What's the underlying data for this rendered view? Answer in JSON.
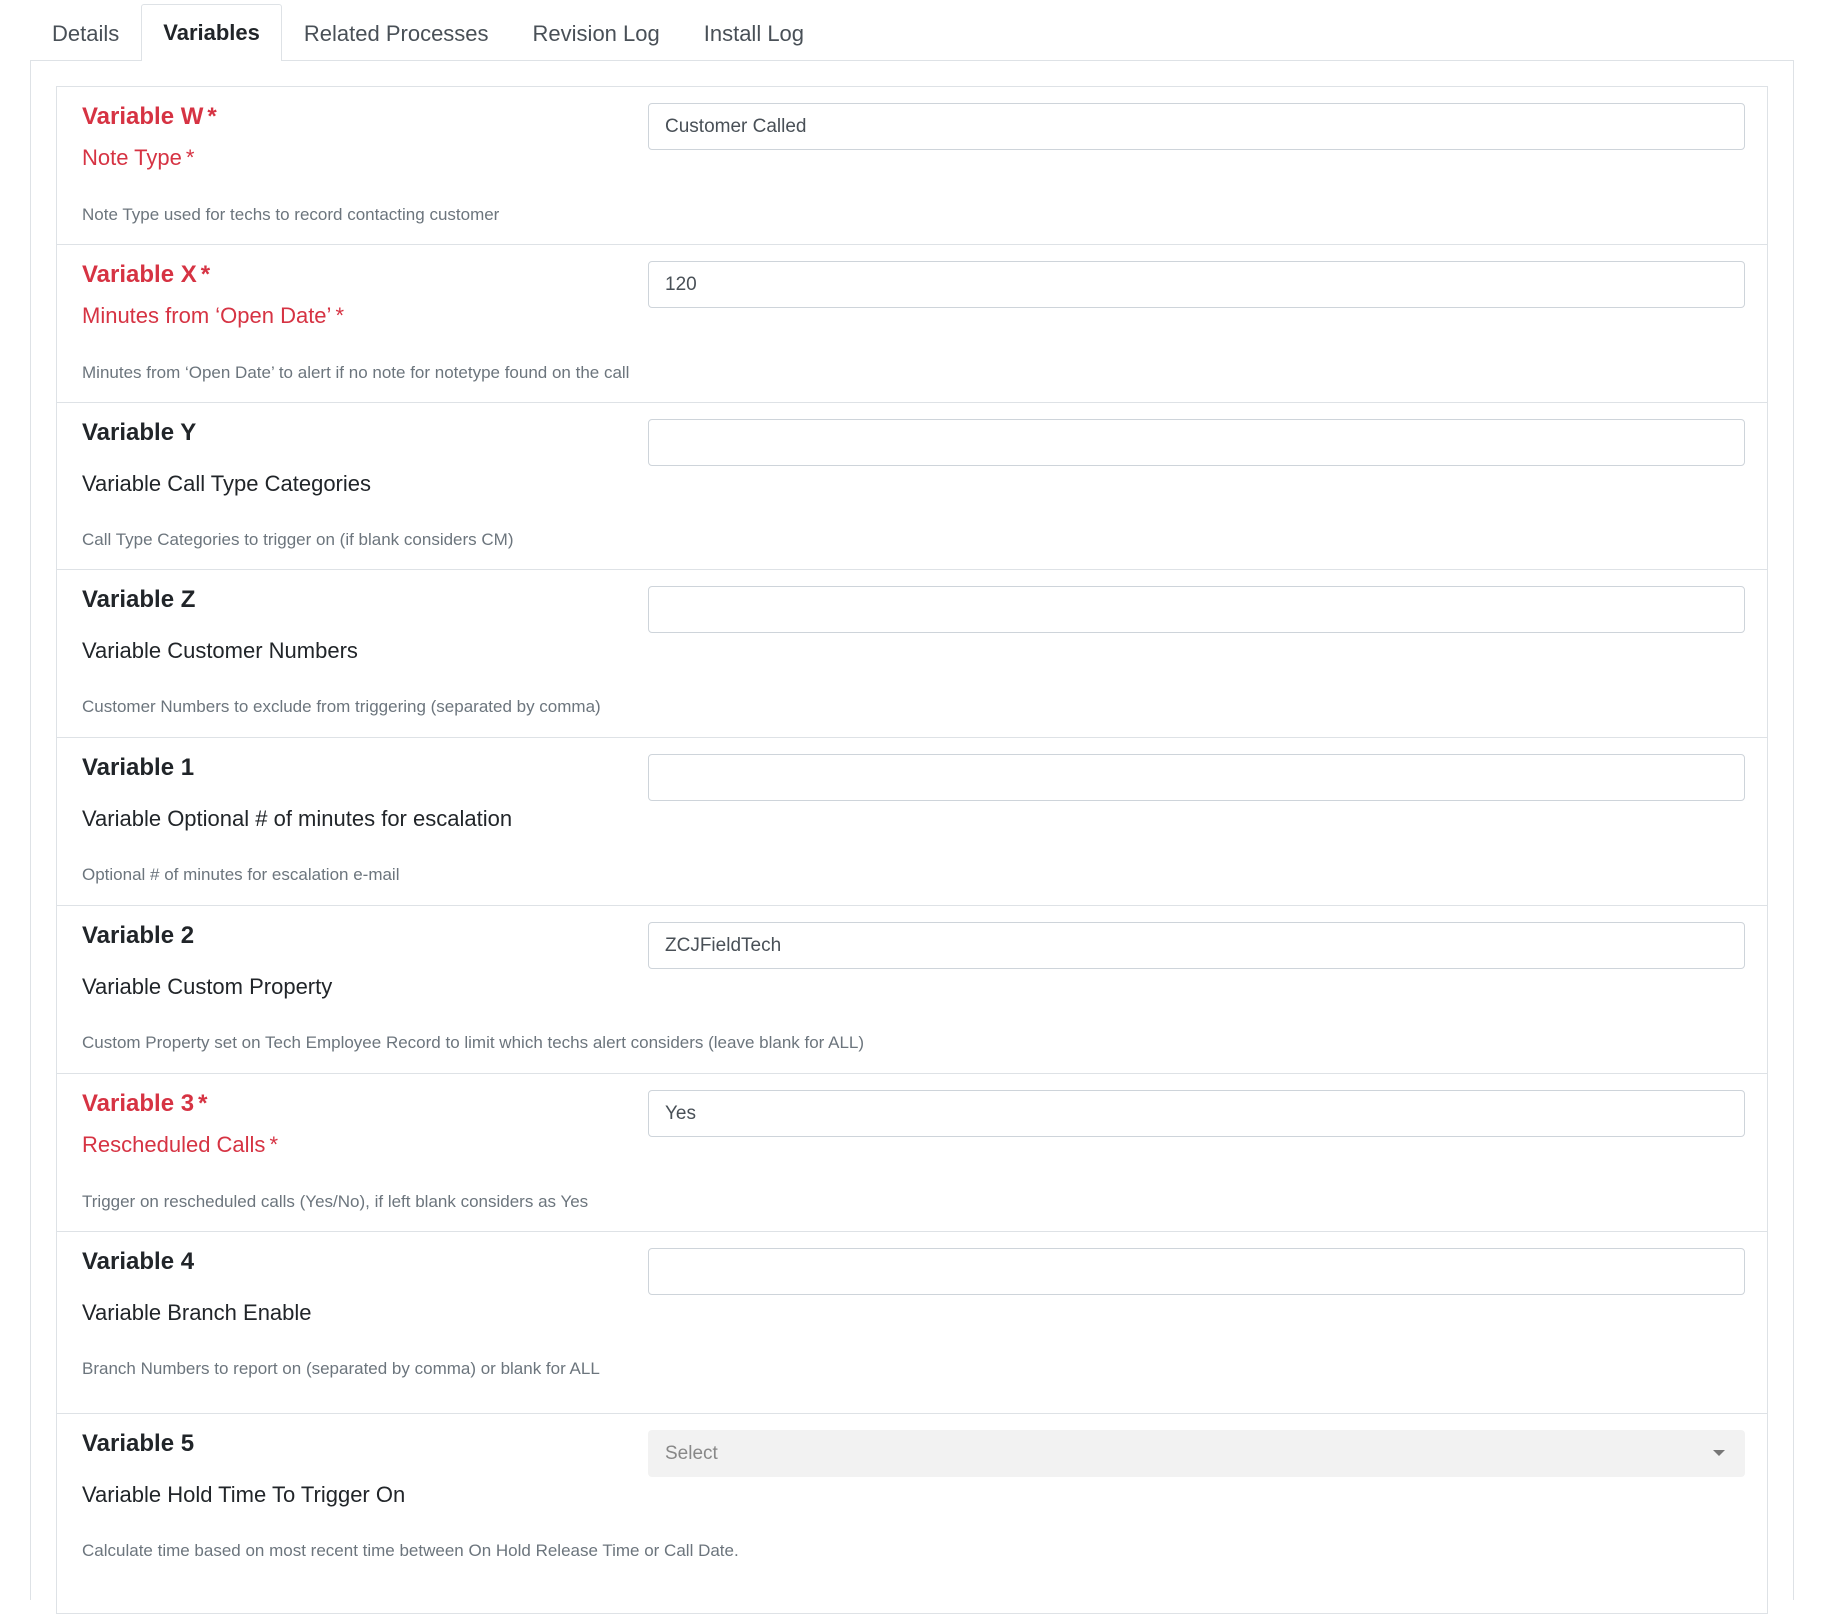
{
  "tabs": [
    {
      "label": "Details",
      "active": false
    },
    {
      "label": "Variables",
      "active": true
    },
    {
      "label": "Related Processes",
      "active": false
    },
    {
      "label": "Revision Log",
      "active": false
    },
    {
      "label": "Install Log",
      "active": false
    }
  ],
  "required_marker": "*",
  "variables": [
    {
      "title": "Variable W",
      "label": "Note Type",
      "help": "Note Type used for techs to record contacting customer",
      "value": "Customer Called",
      "required": true
    },
    {
      "title": "Variable X",
      "label": "Minutes from ‘Open Date’",
      "help": "Minutes from ‘Open Date’ to alert if no note for notetype found on the call",
      "value": "120",
      "required": true
    },
    {
      "title": "Variable Y",
      "label": "Variable Call Type Categories",
      "help": "Call Type Categories to trigger on (if blank considers CM)",
      "value": "",
      "required": false
    },
    {
      "title": "Variable Z",
      "label": "Variable Customer Numbers",
      "help": "Customer Numbers to exclude from triggering (separated by comma)",
      "value": "",
      "required": false
    },
    {
      "title": "Variable 1",
      "label": "Variable Optional # of minutes for escalation",
      "help": "Optional # of minutes for escalation e-mail",
      "value": "",
      "required": false
    },
    {
      "title": "Variable 2",
      "label": "Variable Custom Property",
      "help": "Custom Property set on Tech Employee Record to limit which techs alert considers (leave blank for ALL)",
      "value": "ZCJFieldTech",
      "required": false
    },
    {
      "title": "Variable 3",
      "label": "Rescheduled Calls",
      "help": "Trigger on rescheduled calls (Yes/No), if left blank considers as Yes",
      "value": "Yes",
      "required": true
    },
    {
      "title": "Variable 4",
      "label": "Variable Branch Enable",
      "help": "Branch Numbers to report on (separated by comma) or blank for ALL",
      "value": "",
      "required": false
    },
    {
      "title": "Variable 5",
      "label": "Variable Hold Time To Trigger On",
      "help": "Calculate time based on most recent  time between On Hold Release Time or Call Date.",
      "select_value": "Select",
      "required": false
    }
  ]
}
